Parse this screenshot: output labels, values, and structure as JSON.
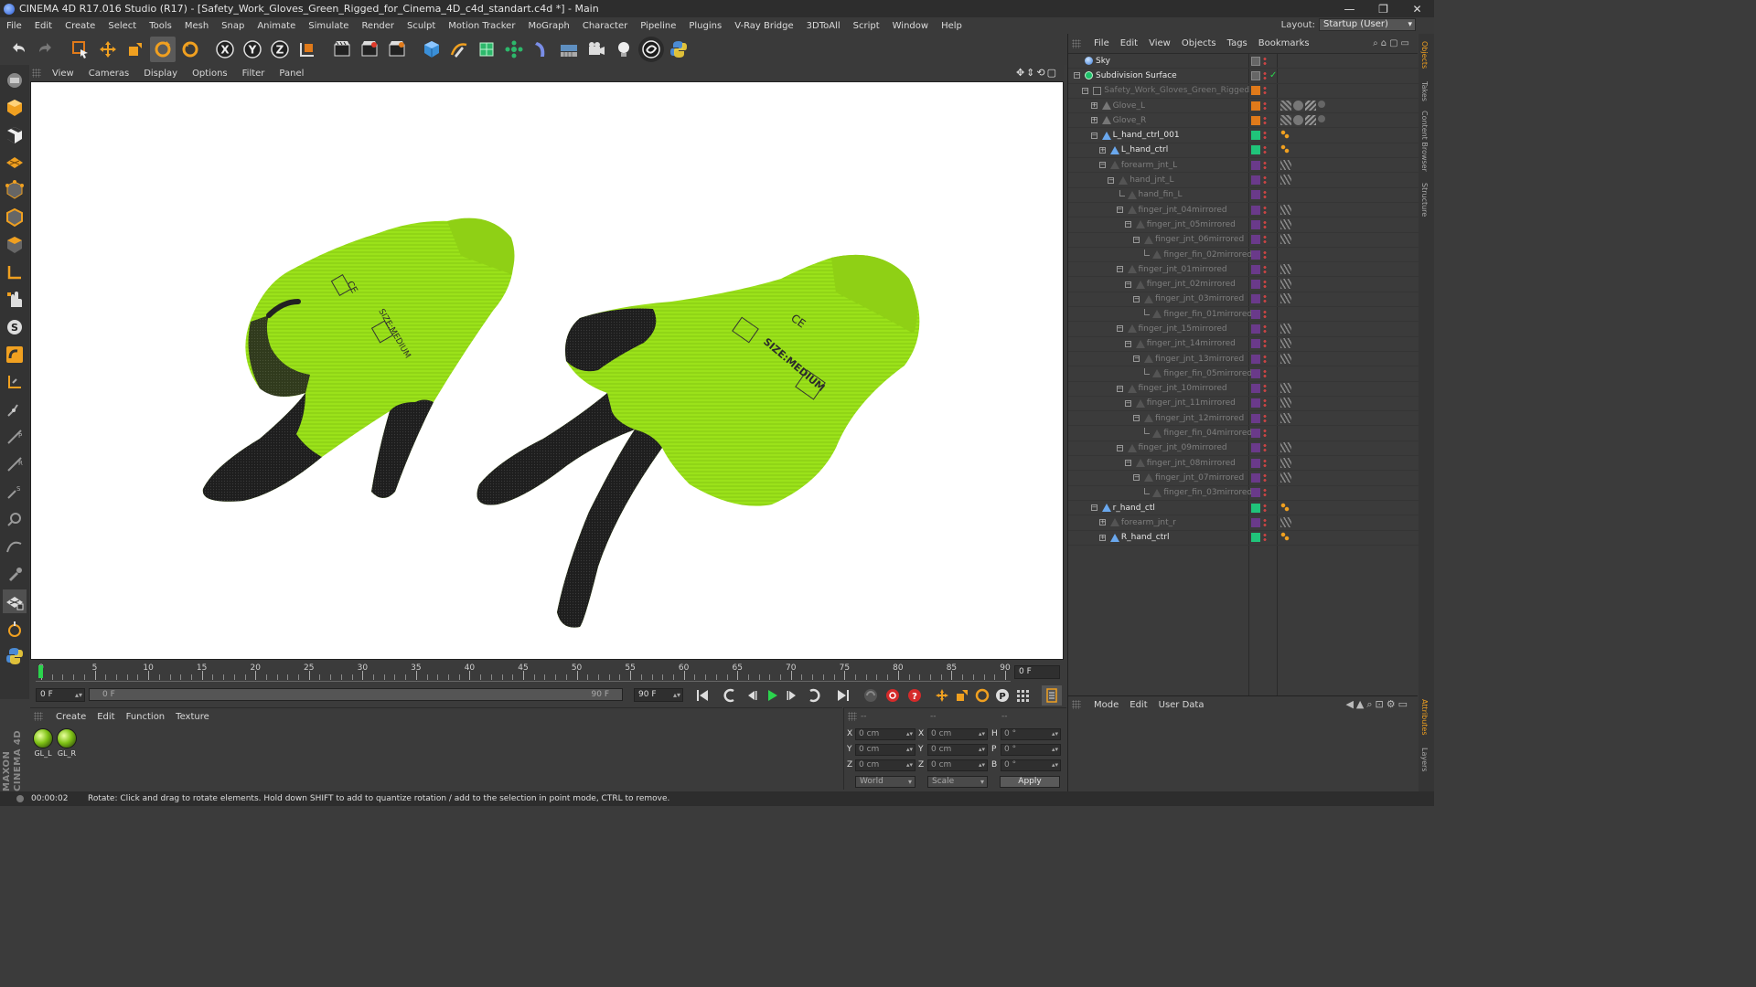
{
  "window": {
    "title": "CINEMA 4D R17.016 Studio (R17) - [Safety_Work_Gloves_Green_Rigged_for_Cinema_4D_c4d_standart.c4d *] - Main",
    "controls": [
      "—",
      "❐",
      "✕"
    ]
  },
  "menubar": {
    "items": [
      "File",
      "Edit",
      "Create",
      "Select",
      "Tools",
      "Mesh",
      "Snap",
      "Animate",
      "Simulate",
      "Render",
      "Sculpt",
      "Motion Tracker",
      "MoGraph",
      "Character",
      "Pipeline",
      "Plugins",
      "V-Ray Bridge",
      "3DToAll",
      "Script",
      "Window",
      "Help"
    ],
    "layout_label": "Layout:",
    "layout_value": "Startup (User)"
  },
  "viewport_menu": {
    "items": [
      "View",
      "Cameras",
      "Display",
      "Options",
      "Filter",
      "Panel"
    ]
  },
  "timeline": {
    "ticks": [
      "0",
      "5",
      "10",
      "15",
      "20",
      "25",
      "30",
      "35",
      "40",
      "45",
      "50",
      "55",
      "60",
      "65",
      "70",
      "75",
      "80",
      "85",
      "90"
    ],
    "current_frame_display": "0 F",
    "start_field": "0 F",
    "range_start": "0 F",
    "range_end": "90 F",
    "end_field": "90 F"
  },
  "material_manager": {
    "menu": [
      "Create",
      "Edit",
      "Function",
      "Texture"
    ],
    "materials": [
      "GL_L",
      "GL_R"
    ]
  },
  "coordinates": {
    "header_left": "--",
    "header_mid": "--",
    "header_right": "--",
    "rows": [
      {
        "axis": "X",
        "pos": "0 cm",
        "axis2": "X",
        "size": "0 cm",
        "rot_label": "H",
        "rot": "0 °"
      },
      {
        "axis": "Y",
        "pos": "0 cm",
        "axis2": "Y",
        "size": "0 cm",
        "rot_label": "P",
        "rot": "0 °"
      },
      {
        "axis": "Z",
        "pos": "0 cm",
        "axis2": "Z",
        "size": "0 cm",
        "rot_label": "B",
        "rot": "0 °"
      }
    ],
    "space_dropdown": "World",
    "mode_dropdown": "Scale",
    "apply_label": "Apply"
  },
  "object_manager": {
    "menu": [
      "File",
      "Edit",
      "View",
      "Objects",
      "Tags",
      "Bookmarks"
    ],
    "objects": [
      {
        "name": "Sky",
        "depth": 0,
        "expander": "",
        "style": "active",
        "icon": "sky",
        "color": ""
      },
      {
        "name": "Subdivision Surface",
        "depth": 0,
        "expander": "−",
        "style": "active",
        "icon": "subdiv",
        "color": ""
      },
      {
        "name": "Safety_Work_Gloves_Green_Rigged",
        "depth": 1,
        "expander": "−",
        "style": "faint",
        "icon": "null",
        "color": "#e07a1a"
      },
      {
        "name": "Glove_L",
        "depth": 2,
        "expander": "+",
        "style": "dim",
        "icon": "poly",
        "color": "#e07a1a"
      },
      {
        "name": "Glove_R",
        "depth": 2,
        "expander": "+",
        "style": "dim",
        "icon": "poly",
        "color": "#e07a1a"
      },
      {
        "name": "L_hand_ctrl_001",
        "depth": 2,
        "expander": "−",
        "style": "active",
        "icon": "ctrl",
        "color": "#20c47a"
      },
      {
        "name": "L_hand_ctrl",
        "depth": 3,
        "expander": "+",
        "style": "active",
        "icon": "ctrl",
        "color": "#20c47a"
      },
      {
        "name": "forearm_jnt_L",
        "depth": 3,
        "expander": "−",
        "style": "dim",
        "icon": "joint",
        "color": "#6a3a8a"
      },
      {
        "name": "hand_jnt_L",
        "depth": 4,
        "expander": "−",
        "style": "dim",
        "icon": "joint",
        "color": "#6a3a8a"
      },
      {
        "name": "hand_fin_L",
        "depth": 5,
        "expander": "",
        "style": "dim",
        "icon": "joint",
        "color": "#6a3a8a"
      },
      {
        "name": "finger_jnt_04mirrored",
        "depth": 5,
        "expander": "−",
        "style": "dim",
        "icon": "joint",
        "color": "#6a3a8a"
      },
      {
        "name": "finger_jnt_05mirrored",
        "depth": 6,
        "expander": "−",
        "style": "dim",
        "icon": "joint",
        "color": "#6a3a8a"
      },
      {
        "name": "finger_jnt_06mirrored",
        "depth": 7,
        "expander": "−",
        "style": "dim",
        "icon": "joint",
        "color": "#6a3a8a"
      },
      {
        "name": "finger_fin_02mirrored",
        "depth": 8,
        "expander": "",
        "style": "dim",
        "icon": "joint",
        "color": "#6a3a8a"
      },
      {
        "name": "finger_jnt_01mirrored",
        "depth": 5,
        "expander": "−",
        "style": "dim",
        "icon": "joint",
        "color": "#6a3a8a"
      },
      {
        "name": "finger_jnt_02mirrored",
        "depth": 6,
        "expander": "−",
        "style": "dim",
        "icon": "joint",
        "color": "#6a3a8a"
      },
      {
        "name": "finger_jnt_03mirrored",
        "depth": 7,
        "expander": "−",
        "style": "dim",
        "icon": "joint",
        "color": "#6a3a8a"
      },
      {
        "name": "finger_fin_01mirrored",
        "depth": 8,
        "expander": "",
        "style": "dim",
        "icon": "joint",
        "color": "#6a3a8a"
      },
      {
        "name": "finger_jnt_15mirrored",
        "depth": 5,
        "expander": "−",
        "style": "dim",
        "icon": "joint",
        "color": "#6a3a8a"
      },
      {
        "name": "finger_jnt_14mirrored",
        "depth": 6,
        "expander": "−",
        "style": "dim",
        "icon": "joint",
        "color": "#6a3a8a"
      },
      {
        "name": "finger_jnt_13mirrored",
        "depth": 7,
        "expander": "−",
        "style": "dim",
        "icon": "joint",
        "color": "#6a3a8a"
      },
      {
        "name": "finger_fin_05mirrored",
        "depth": 8,
        "expander": "",
        "style": "dim",
        "icon": "joint",
        "color": "#6a3a8a"
      },
      {
        "name": "finger_jnt_10mirrored",
        "depth": 5,
        "expander": "−",
        "style": "dim",
        "icon": "joint",
        "color": "#6a3a8a"
      },
      {
        "name": "finger_jnt_11mirrored",
        "depth": 6,
        "expander": "−",
        "style": "dim",
        "icon": "joint",
        "color": "#6a3a8a"
      },
      {
        "name": "finger_jnt_12mirrored",
        "depth": 7,
        "expander": "−",
        "style": "dim",
        "icon": "joint",
        "color": "#6a3a8a"
      },
      {
        "name": "finger_fin_04mirrored",
        "depth": 8,
        "expander": "",
        "style": "dim",
        "icon": "joint",
        "color": "#6a3a8a"
      },
      {
        "name": "finger_jnt_09mirrored",
        "depth": 5,
        "expander": "−",
        "style": "dim",
        "icon": "joint",
        "color": "#6a3a8a"
      },
      {
        "name": "finger_jnt_08mirrored",
        "depth": 6,
        "expander": "−",
        "style": "dim",
        "icon": "joint",
        "color": "#6a3a8a"
      },
      {
        "name": "finger_jnt_07mirrored",
        "depth": 7,
        "expander": "−",
        "style": "dim",
        "icon": "joint",
        "color": "#6a3a8a"
      },
      {
        "name": "finger_fin_03mirrored",
        "depth": 8,
        "expander": "",
        "style": "dim",
        "icon": "joint",
        "color": "#6a3a8a"
      },
      {
        "name": "r_hand_ctl",
        "depth": 2,
        "expander": "−",
        "style": "active",
        "icon": "ctrl",
        "color": "#20c47a"
      },
      {
        "name": "forearm_jnt_r",
        "depth": 3,
        "expander": "+",
        "style": "dim",
        "icon": "joint",
        "color": "#6a3a8a"
      },
      {
        "name": "R_hand_ctrl",
        "depth": 3,
        "expander": "+",
        "style": "active",
        "icon": "ctrl",
        "color": "#20c47a"
      }
    ]
  },
  "attribute_manager": {
    "menu": [
      "Mode",
      "Edit",
      "User Data"
    ]
  },
  "right_tabs": [
    "Objects",
    "Takes",
    "Content Browser",
    "Structure",
    "Attributes",
    "Layers"
  ],
  "maxon_logo": "MAXON CINEMA 4D",
  "status": {
    "time": "00:00:02",
    "message": "Rotate: Click and drag to rotate elements. Hold down SHIFT to add to quantize rotation / add to the selection in point mode, CTRL to remove."
  },
  "colors": {
    "glove_green": "#9be21a",
    "glove_black": "#1e1e1e",
    "ui_bg": "#3b3b3b",
    "timeline_cursor": "#2bd44d"
  },
  "icons": {
    "toolbar": [
      "undo-icon",
      "redo-icon",
      "live-select-icon",
      "move-icon",
      "scale-icon",
      "rotate-icon",
      "recent-tool-icon",
      "x-axis-icon",
      "y-axis-icon",
      "z-axis-icon",
      "coordinate-system-icon",
      "render-view-icon",
      "render-picture-viewer-icon",
      "edit-render-settings-icon",
      "cube-icon",
      "pen-icon",
      "subdivision-icon",
      "array-icon",
      "deformer-icon",
      "floor-icon",
      "camera-icon",
      "light-icon",
      "vray-icon",
      "python-icon"
    ]
  }
}
